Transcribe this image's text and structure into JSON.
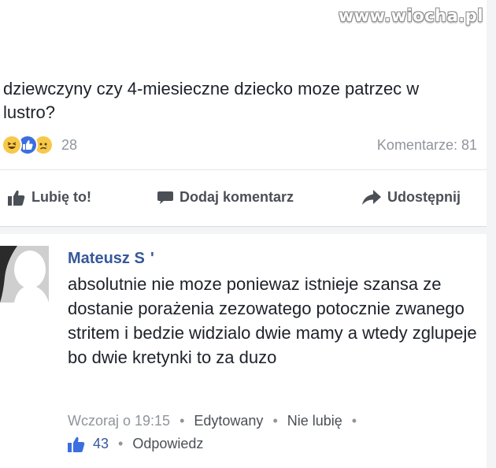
{
  "watermark": "www.wiocha.pl",
  "post": {
    "text": "dziewczyny czy 4-miesieczne dziecko moze patrzec w lustro?",
    "reaction_count": "28",
    "comments_label": "Komentarze: 81",
    "reaction_icons": [
      "haha-icon",
      "like-icon",
      "sad-icon"
    ],
    "actions": {
      "like": "Lubię to!",
      "comment": "Dodaj komentarz",
      "share": "Udostępnij"
    }
  },
  "comment": {
    "author": "Mateusz S",
    "author_extra": "'",
    "text": "absolutnie nie moze poniewaz istnieje szansa ze dostanie porażenia zezowatego potocznie zwanego stritem i bedzie widzialo dwie mamy a wtedy zglupeje bo dwie kretynki to za duzo",
    "timestamp": "Wczoraj o 19:15",
    "edited": "Edytowany",
    "unlike": "Nie lubię",
    "likes": "43",
    "reply": "Odpowiedz"
  },
  "colors": {
    "link_blue": "#365899",
    "like_blue": "#3b6fe0",
    "meta_gray": "#90949c",
    "action_gray": "#4b4f56"
  }
}
